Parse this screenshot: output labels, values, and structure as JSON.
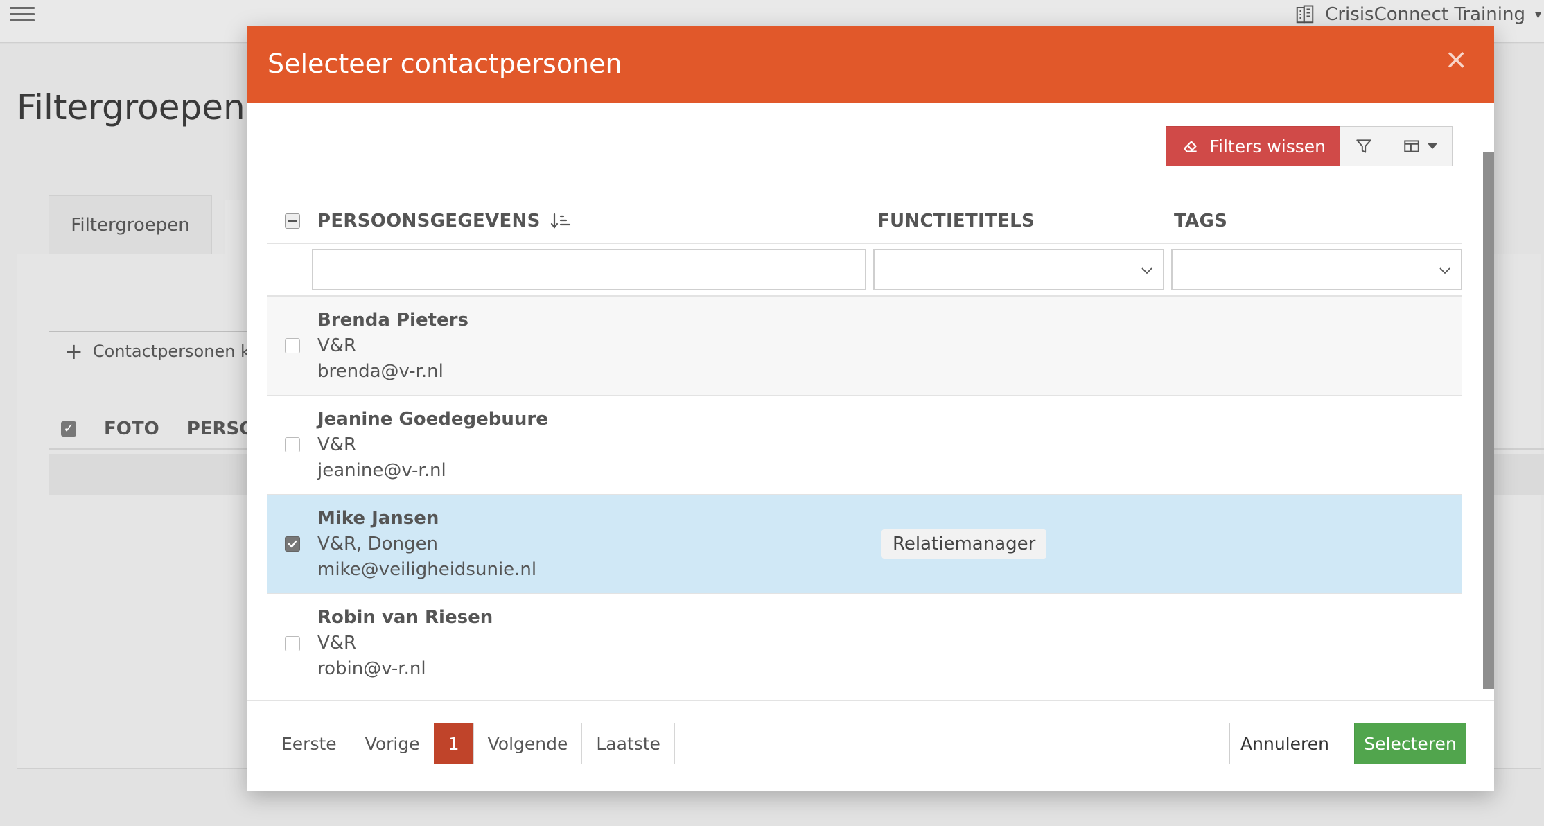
{
  "background": {
    "app_title": "CrisisConnect Training",
    "page_title": "Filtergroepen b",
    "tab_label": "Filtergroepen",
    "add_button_label": "Contactpersonen ko",
    "table_headers": [
      "FOTO",
      "PERSOO"
    ]
  },
  "modal": {
    "title": "Selecteer contactpersonen",
    "close_label": "×",
    "toolbar": {
      "clear_filters_label": "Filters wissen"
    },
    "columns": {
      "person": "PERSOONSGEGEVENS",
      "function": "FUNCTIETITELS",
      "tags": "TAGS"
    },
    "filters": {
      "person_value": "",
      "function_value": "",
      "tags_value": ""
    },
    "rows": [
      {
        "name": "Brenda Pieters",
        "org": "V&R",
        "email": "brenda@v-r.nl",
        "function": "",
        "checked": false
      },
      {
        "name": "Jeanine Goedegebuure",
        "org": "V&R",
        "email": "jeanine@v-r.nl",
        "function": "",
        "checked": false
      },
      {
        "name": "Mike Jansen",
        "org": "V&R, Dongen",
        "email": "mike@veiligheidsunie.nl",
        "function": "Relatiemanager",
        "checked": true
      },
      {
        "name": "Robin van Riesen",
        "org": "V&R",
        "email": "robin@v-r.nl",
        "function": "",
        "checked": false
      }
    ],
    "pagination": {
      "first": "Eerste",
      "previous": "Vorige",
      "current": "1",
      "next": "Volgende",
      "last": "Laatste"
    },
    "buttons": {
      "cancel": "Annuleren",
      "select": "Selecteren"
    }
  },
  "colors": {
    "header": "#e1582a",
    "clear_filters": "#d04a48",
    "selected_row": "#d0e8f6",
    "active_page": "#c0442a",
    "select_button": "#51a54d"
  }
}
